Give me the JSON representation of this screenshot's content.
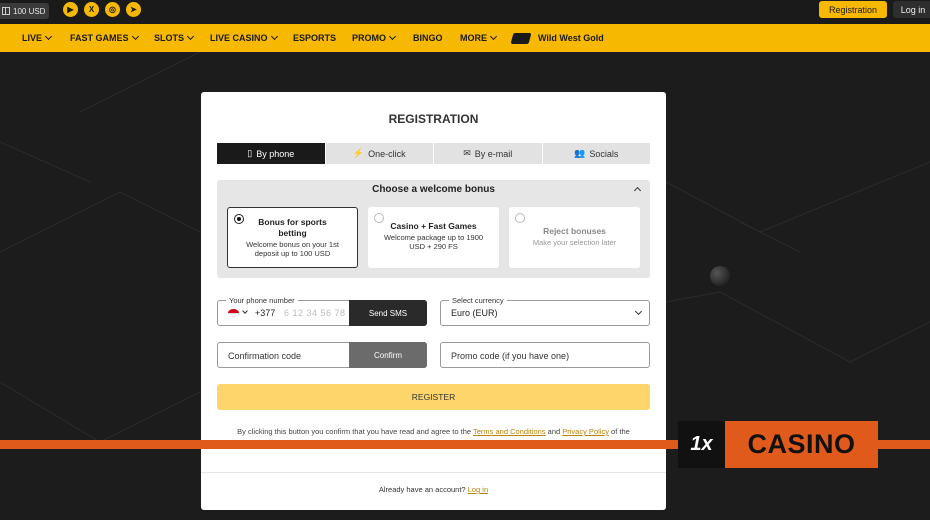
{
  "topbar": {
    "bonus_amount": "100 USD",
    "socials": [
      {
        "icon": "youtube-icon",
        "glyph": "▶"
      },
      {
        "icon": "x-icon",
        "glyph": "X"
      },
      {
        "icon": "instagram-icon",
        "glyph": "◎"
      },
      {
        "icon": "telegram-icon",
        "glyph": "➤"
      }
    ],
    "registration_label": "Registration",
    "login_label": "Log in"
  },
  "nav": {
    "items": [
      {
        "label": "LIVE",
        "dropdown": true
      },
      {
        "label": "FAST GAMES",
        "dropdown": true
      },
      {
        "label": "SLOTS",
        "dropdown": true
      },
      {
        "label": "LIVE CASINO",
        "dropdown": true
      },
      {
        "label": "ESPORTS",
        "dropdown": false
      },
      {
        "label": "PROMO",
        "dropdown": true
      },
      {
        "label": "BINGO",
        "dropdown": false
      },
      {
        "label": "MORE",
        "dropdown": true
      }
    ],
    "featured": "Wild West Gold"
  },
  "modal": {
    "title": "REGISTRATION",
    "tabs": [
      {
        "label": "By phone",
        "icon": "phone-icon",
        "glyph": "▯",
        "active": true
      },
      {
        "label": "One-click",
        "icon": "lightning-icon",
        "glyph": "⚡",
        "active": false
      },
      {
        "label": "By e-mail",
        "icon": "envelope-icon",
        "glyph": "✉",
        "active": false
      },
      {
        "label": "Socials",
        "icon": "users-icon",
        "glyph": "👥",
        "active": false
      }
    ],
    "bonus": {
      "heading": "Choose a welcome bonus",
      "options": [
        {
          "title": "Bonus for sports betting",
          "desc": "Welcome bonus on your 1st deposit up to 100 USD",
          "selected": true
        },
        {
          "title": "Casino + Fast Games",
          "desc": "Welcome package up to 1900 USD + 290 FS",
          "selected": false
        },
        {
          "title": "Reject bonuses",
          "desc": "Make your selection later",
          "selected": false
        }
      ]
    },
    "phone": {
      "label": "Your phone number",
      "country_code": "+377",
      "placeholder": "6 12 34 56 78",
      "send_sms": "Send SMS"
    },
    "currency": {
      "label": "Select currency",
      "value": "Euro (EUR)"
    },
    "confirmation": {
      "placeholder": "Confirmation code",
      "confirm_label": "Confirm"
    },
    "promo": {
      "placeholder": "Promo code (if you have one)"
    },
    "register_label": "REGISTER",
    "terms": {
      "prefix": "By clicking this button you confirm that you have read and agree to the",
      "terms_link": "Terms and Conditions",
      "and": "and",
      "privacy_link": "Privacy Policy",
      "suffix": "of the"
    },
    "footer": {
      "text": "Already have an account?",
      "login_link": "Log in"
    }
  },
  "watermark": {
    "mark": "1x",
    "word": "CASINO",
    "accent": "#e05a1c"
  },
  "colors": {
    "brand_yellow": "#f6b800",
    "register_yellow": "#fdd56a",
    "background": "#1c1c1c"
  }
}
